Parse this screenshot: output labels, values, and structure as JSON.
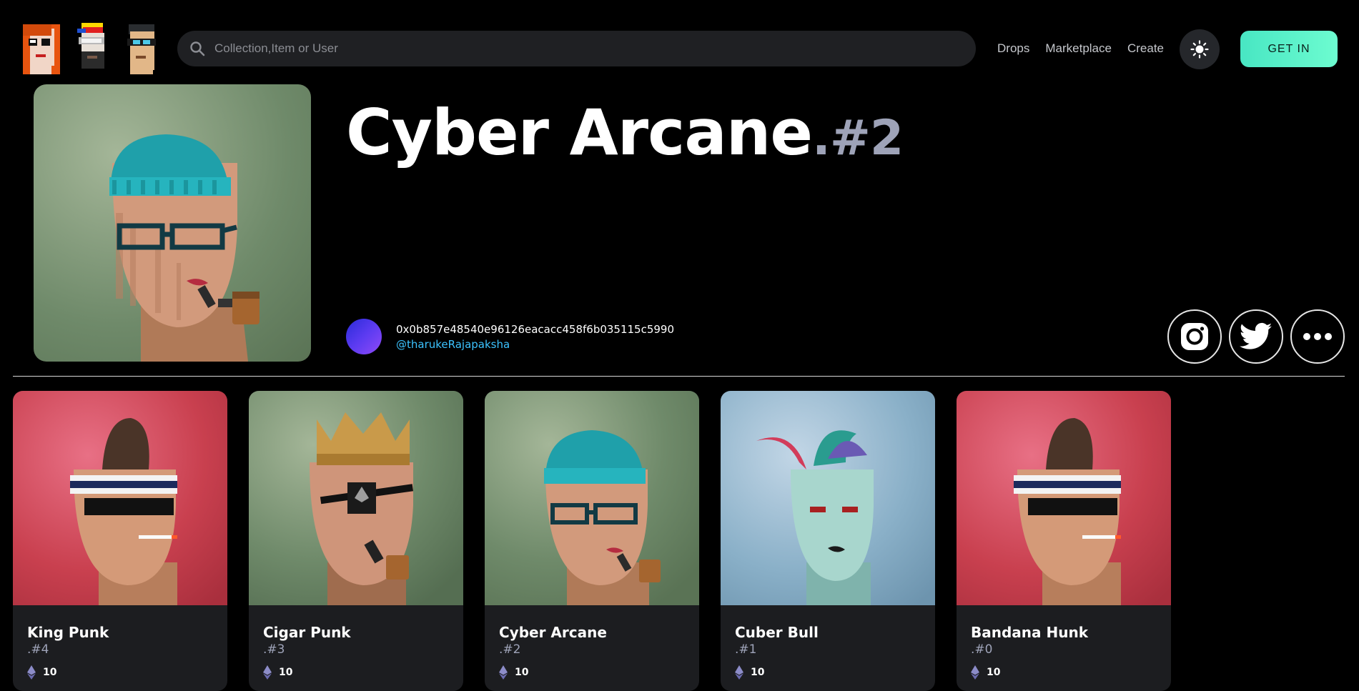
{
  "header": {
    "logos": [
      "punk-logo-red-hair",
      "punk-logo-cap",
      "punk-logo-glasses"
    ],
    "search_placeholder": "Collection,Item or User",
    "nav": [
      "Drops",
      "Marketplace",
      "Create"
    ],
    "theme_icon": "sun-icon",
    "cta_label": "GET IN"
  },
  "hero": {
    "title": "Cyber Arcane",
    "number": ".#2",
    "owner_address": "0x0b857e48540e96126eacacc458f6b035115c5990",
    "owner_handle": "@tharukeRajapaksha",
    "socials": [
      "instagram-icon",
      "twitter-icon",
      "more-icon"
    ]
  },
  "cards": [
    {
      "name": "King Punk",
      "number": ".#4",
      "price": "10",
      "theme": "red"
    },
    {
      "name": "Cigar Punk",
      "number": ".#3",
      "price": "10",
      "theme": "green"
    },
    {
      "name": "Cyber Arcane",
      "number": ".#2",
      "price": "10",
      "theme": "green"
    },
    {
      "name": "Cuber Bull",
      "number": ".#1",
      "price": "10",
      "theme": "blue"
    },
    {
      "name": "Bandana Hunk",
      "number": ".#0",
      "price": "10",
      "theme": "red"
    }
  ],
  "colors": {
    "accent": "#5ff5cf",
    "handle": "#3cc3ff",
    "number_muted": "#9ea3b8",
    "card_bg": "#1c1d20"
  }
}
